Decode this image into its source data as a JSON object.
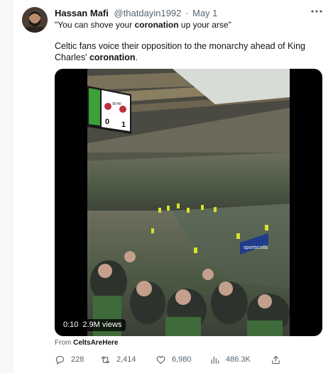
{
  "author": {
    "name": "Hassan Mafi",
    "handle": "@thatdayin1992",
    "separator": "·",
    "date": "May 1"
  },
  "post": {
    "quote_open": "\"You can shove your ",
    "quote_bold": "coronation",
    "quote_close": " up your arse\"",
    "body_prefix": "Celtic fans voice their opposition to the monarchy ahead of King Charles' ",
    "body_bold": "coronation",
    "body_suffix": "."
  },
  "media": {
    "duration": "0:10",
    "views": "2.9M views",
    "scoreboard_home": "0",
    "scoreboard_away": "1",
    "scoreboard_time": "90:40",
    "ad_board": "sportscotla"
  },
  "source": {
    "prefix": "From ",
    "name": "CeltsAreHere"
  },
  "actions": {
    "replies": "228",
    "retweets": "2,414",
    "likes": "6,980",
    "views": "486.3K"
  },
  "colors": {
    "text": "#0f1419",
    "muted": "#536471",
    "background": "#f7f9f9"
  },
  "icons": [
    "more-icon",
    "reply-icon",
    "retweet-icon",
    "like-icon",
    "views-icon",
    "share-icon"
  ]
}
